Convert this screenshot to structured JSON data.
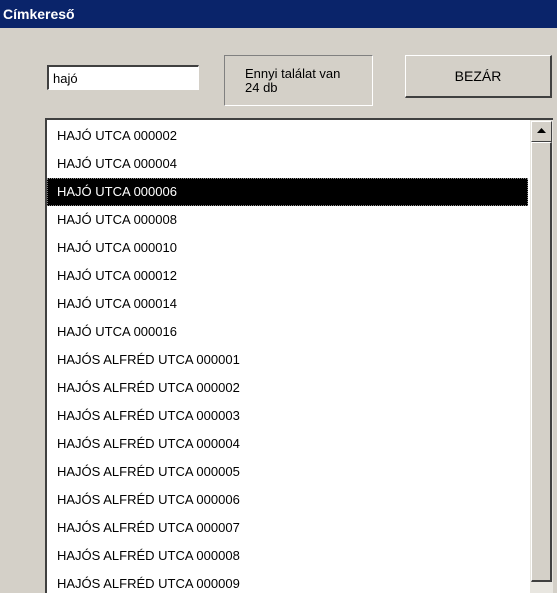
{
  "window": {
    "title": "Címkereső"
  },
  "search": {
    "value": "hajó"
  },
  "result": {
    "line1": "Ennyi találat van",
    "line2": "24 db"
  },
  "close_button": {
    "label": "BEZÁR"
  },
  "list": {
    "selected_index": 2,
    "items": [
      "HAJÓ UTCA 000002",
      "HAJÓ UTCA 000004",
      "HAJÓ UTCA 000006",
      "HAJÓ UTCA 000008",
      "HAJÓ UTCA 000010",
      "HAJÓ UTCA 000012",
      "HAJÓ UTCA 000014",
      "HAJÓ UTCA 000016",
      "HAJÓS ALFRÉD UTCA 000001",
      "HAJÓS ALFRÉD UTCA 000002",
      "HAJÓS ALFRÉD UTCA 000003",
      "HAJÓS ALFRÉD UTCA 000004",
      "HAJÓS ALFRÉD UTCA 000005",
      "HAJÓS ALFRÉD UTCA 000006",
      "HAJÓS ALFRÉD UTCA 000007",
      "HAJÓS ALFRÉD UTCA 000008",
      "HAJÓS ALFRÉD UTCA 000009"
    ]
  },
  "icons": {
    "scroll_up": "up-arrow-icon"
  }
}
